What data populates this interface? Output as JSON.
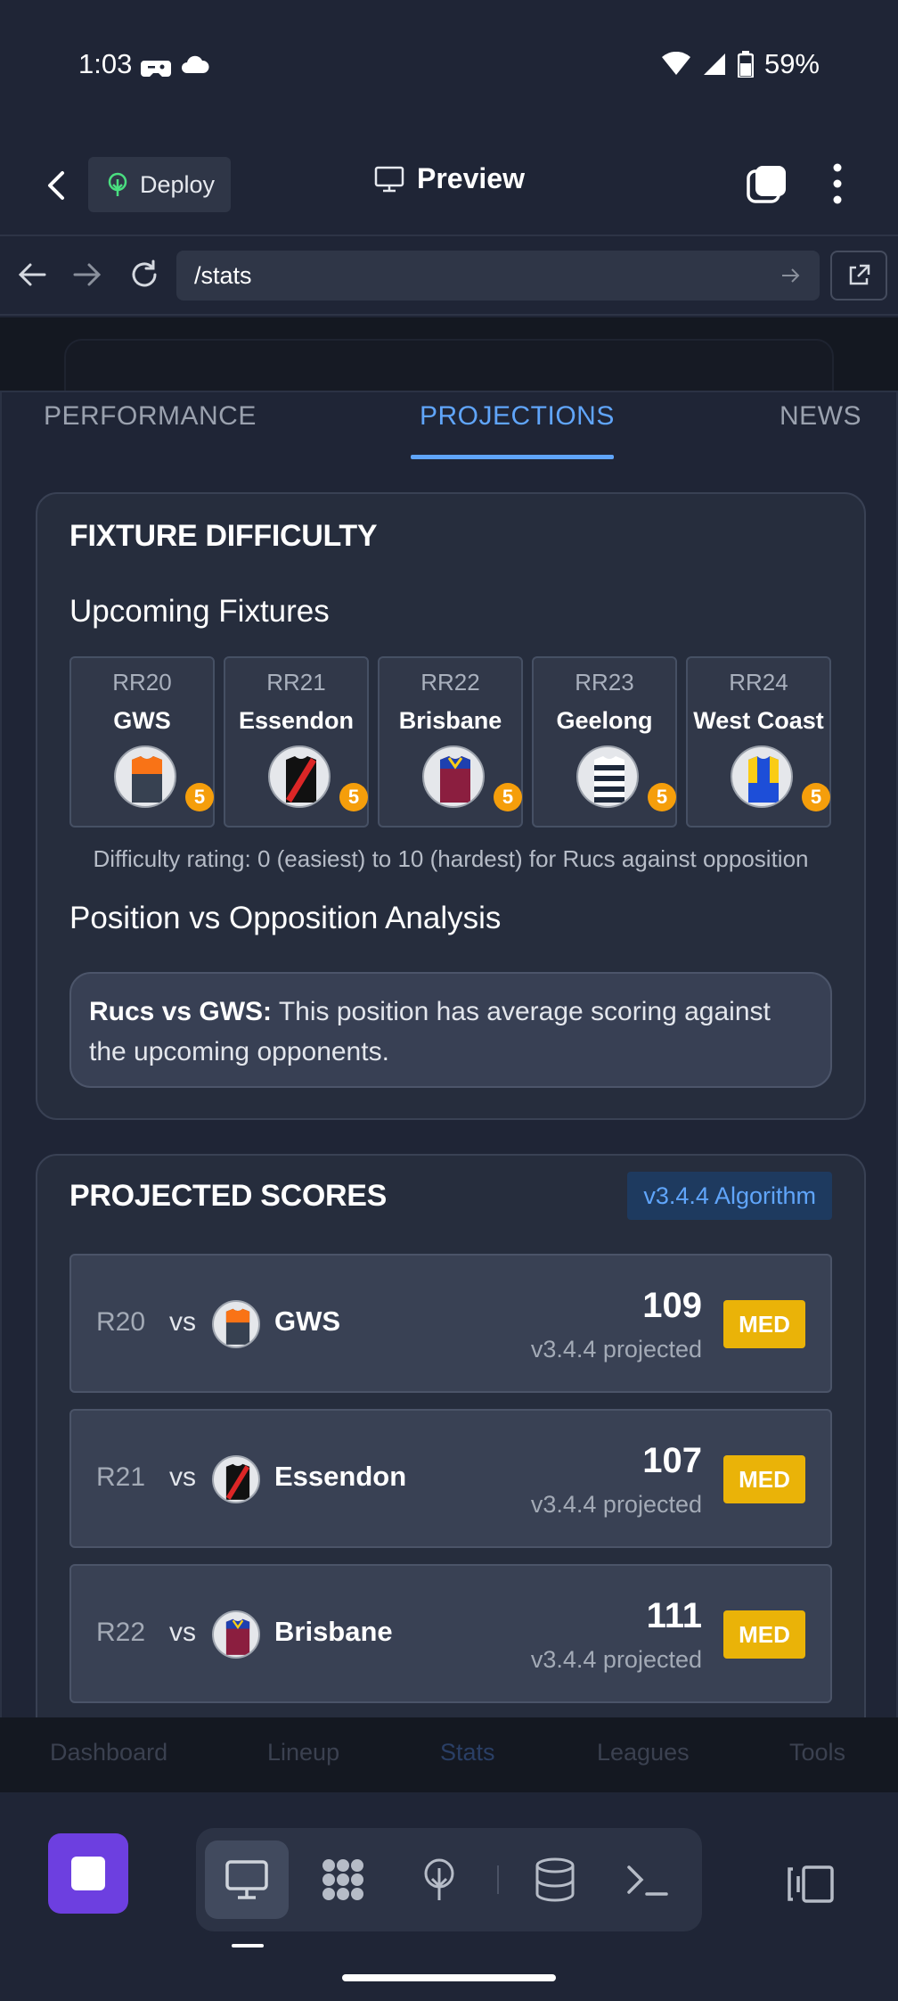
{
  "status_bar": {
    "time": "1:03",
    "battery": "59%"
  },
  "app_bar": {
    "deploy_label": "Deploy",
    "preview_label": "Preview"
  },
  "url_bar": {
    "url": "/stats"
  },
  "tabs": [
    {
      "label": "PERFORMANCE"
    },
    {
      "label": "PROJECTIONS"
    },
    {
      "label": "NEWS"
    }
  ],
  "fixture_difficulty": {
    "title": "FIXTURE DIFFICULTY",
    "subtitle": "Upcoming Fixtures",
    "fixtures": [
      {
        "round": "RR20",
        "team": "GWS",
        "difficulty": "5",
        "icon": "gws-jersey-icon"
      },
      {
        "round": "RR21",
        "team": "Essendon",
        "difficulty": "5",
        "icon": "essendon-jersey-icon"
      },
      {
        "round": "RR22",
        "team": "Brisbane",
        "difficulty": "5",
        "icon": "brisbane-jersey-icon"
      },
      {
        "round": "RR23",
        "team": "Geelong",
        "difficulty": "5",
        "icon": "geelong-jersey-icon"
      },
      {
        "round": "RR24",
        "team": "West Coast",
        "difficulty": "5",
        "icon": "westcoast-jersey-icon"
      }
    ],
    "note": "Difficulty rating: 0 (easiest) to 10 (hardest) for Rucs against opposition",
    "analysis_title": "Position vs Opposition Analysis",
    "analysis_bold": "Rucs vs GWS:",
    "analysis_text": " This position has average scoring against the upcoming opponents."
  },
  "projected_scores": {
    "title": "PROJECTED SCORES",
    "algorithm_badge": "v3.4.4 Algorithm",
    "rows": [
      {
        "round": "R20",
        "vs": "vs",
        "team": "GWS",
        "score": "109",
        "label": "v3.4.4 projected",
        "badge": "MED"
      },
      {
        "round": "R21",
        "vs": "vs",
        "team": "Essendon",
        "score": "107",
        "label": "v3.4.4 projected",
        "badge": "MED"
      },
      {
        "round": "R22",
        "vs": "vs",
        "team": "Brisbane",
        "score": "111",
        "label": "v3.4.4 projected",
        "badge": "MED"
      }
    ]
  },
  "app_nav": [
    "Dashboard",
    "Lineup",
    "Stats",
    "Leagues",
    "Tools"
  ],
  "colors": {
    "accent": "#60a5fa",
    "difficulty_badge": "#f59e0b",
    "med_badge": "#eab308",
    "stop_button": "#6d3fe0"
  }
}
